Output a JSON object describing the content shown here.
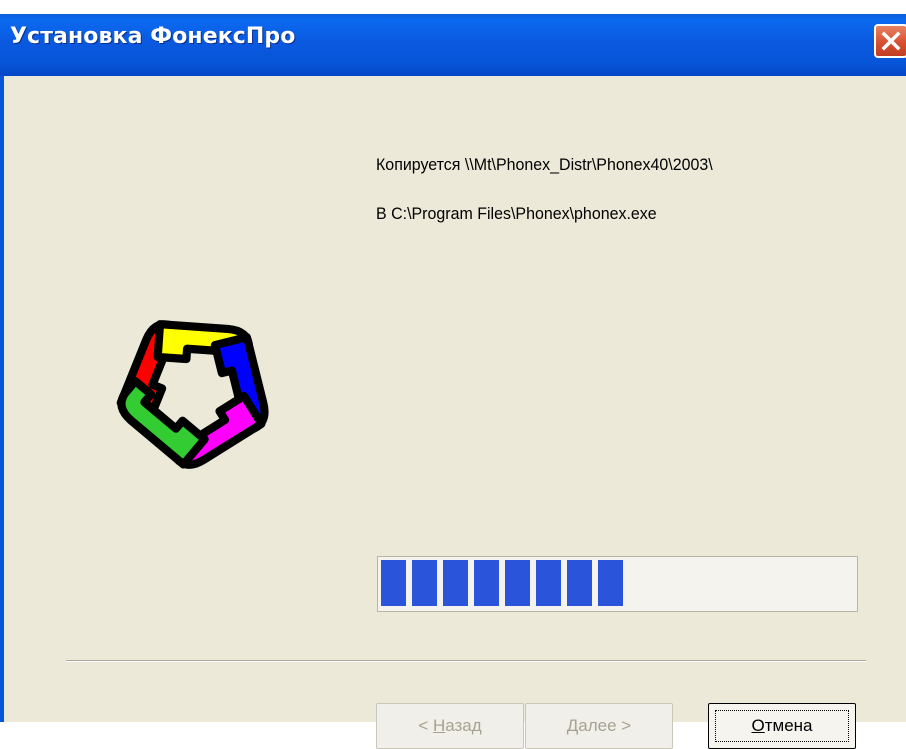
{
  "window": {
    "title": "Установка ФонексПро",
    "close_icon": "close-icon"
  },
  "status": {
    "copying_line": "Копируется \\\\Mt\\Phonex_Distr\\Phonex40\\2003\\",
    "destination_line": "В C:\\Program Files\\Phonex\\phonex.exe"
  },
  "logo": {
    "icon": "phonex-logo-icon",
    "colors": [
      "#ff0000",
      "#ffff00",
      "#0000ff",
      "#ff00ff",
      "#33cc33"
    ]
  },
  "progress": {
    "fraction": 0.53,
    "color": "#2a54d9"
  },
  "buttons": {
    "back": {
      "accel": "Н",
      "rest": "азад",
      "prefix": "< ",
      "enabled": false
    },
    "next": {
      "accel": "Д",
      "rest": "алее",
      "suffix": " >",
      "enabled": false
    },
    "cancel": {
      "accel": "О",
      "rest": "тмена",
      "enabled": true
    }
  },
  "colors": {
    "titlebar": "#0a59df",
    "dialog_bg": "#ece9d8",
    "close_button": "#d65033"
  }
}
